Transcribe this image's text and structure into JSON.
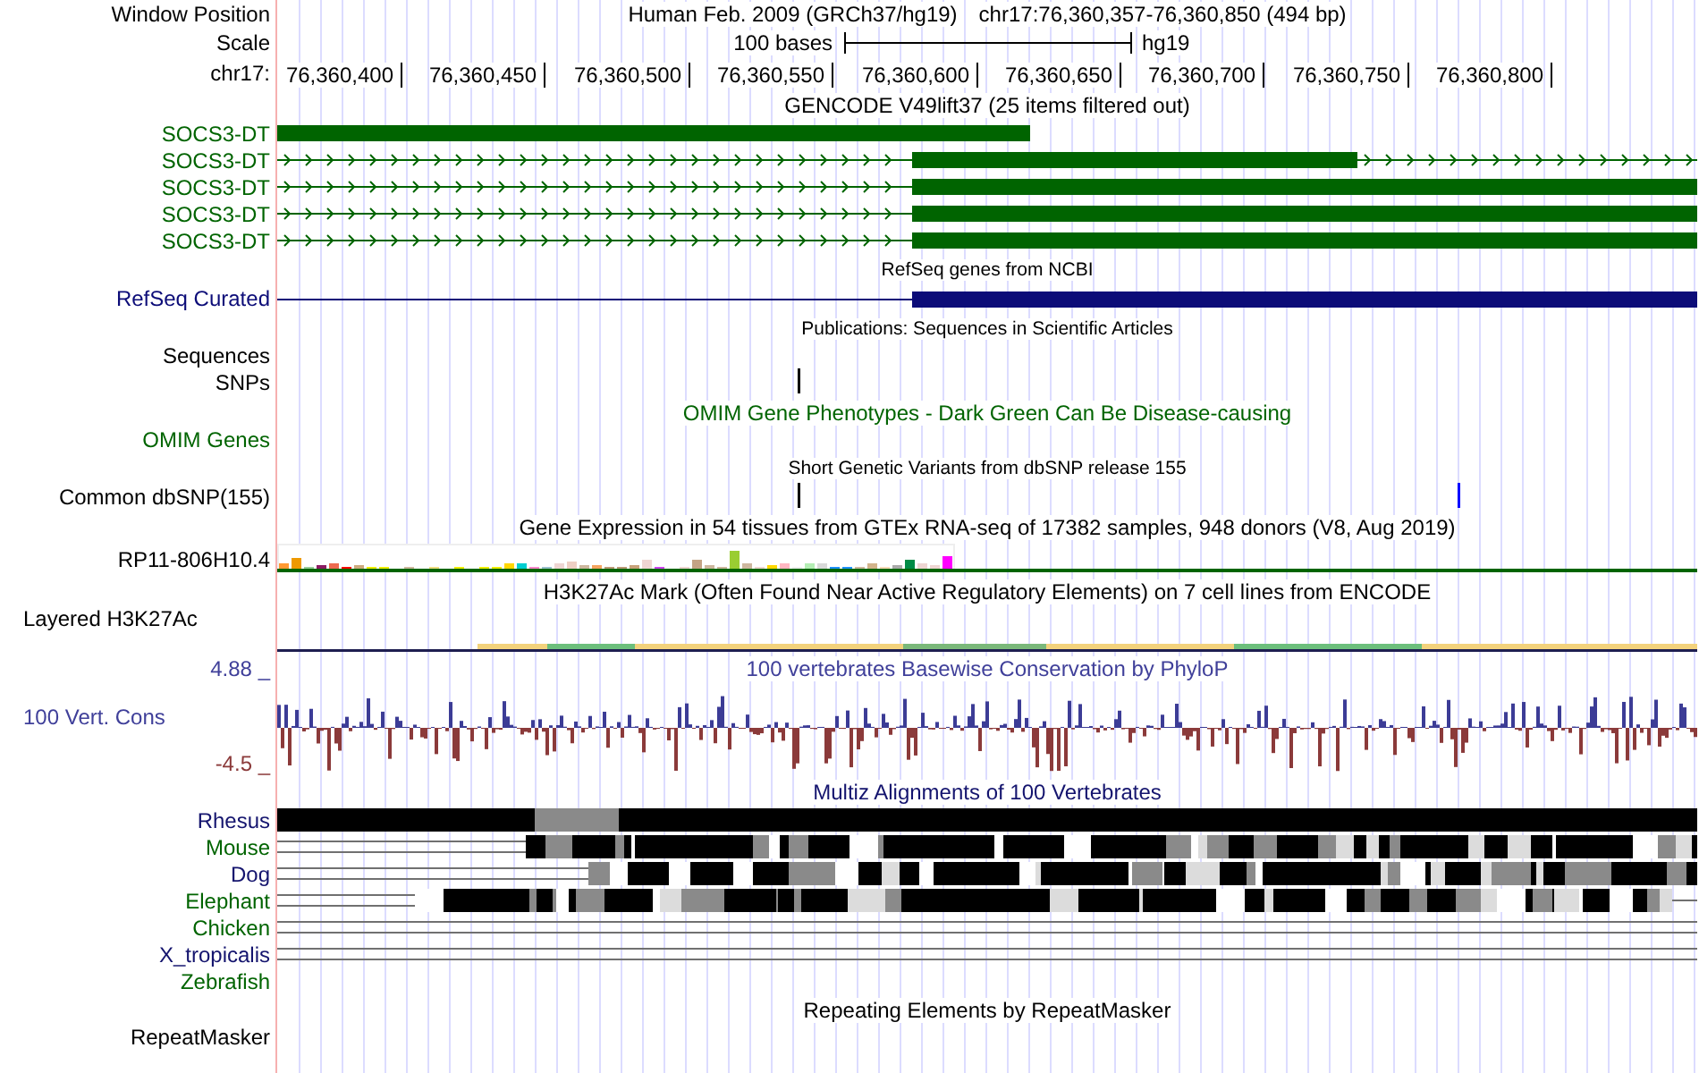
{
  "header": {
    "position_label": "Window Position",
    "assembly": "Human Feb. 2009 (GRCh37/hg19)",
    "position": "chr17:76,360,357-76,360,850 (494 bp)",
    "scale_label": "Scale",
    "scale_text": "100 bases",
    "scale_db": "hg19",
    "ruler_label": "chr17:",
    "ticks": [
      "76,360,400",
      "76,360,450",
      "76,360,500",
      "76,360,550",
      "76,360,600",
      "76,360,650",
      "76,360,700",
      "76,360,750",
      "76,360,800"
    ]
  },
  "tracks": [
    {
      "kind": "title",
      "text": "GENCODE V49lift37 (25 items filtered out)",
      "color": "#000000"
    },
    {
      "kind": "genes",
      "transcripts": [
        {
          "label": "SOCS3-DT",
          "kind": "single-block",
          "color": "#006400"
        },
        {
          "label": "SOCS3-DT",
          "kind": "short-exon",
          "color": "#006400"
        },
        {
          "label": "SOCS3-DT",
          "kind": "long-exon",
          "color": "#006400"
        },
        {
          "label": "SOCS3-DT",
          "kind": "long-exon",
          "color": "#006400"
        },
        {
          "label": "SOCS3-DT",
          "kind": "long-exon",
          "color": "#006400"
        }
      ]
    },
    {
      "kind": "note",
      "text": "RefSeq genes from NCBI"
    },
    {
      "kind": "refseq",
      "label": "RefSeq Curated",
      "color": "#0c0c78"
    },
    {
      "kind": "note",
      "text": "Publications: Sequences in Scientific Articles"
    },
    {
      "kind": "empty",
      "label": "Sequences",
      "color": "#000000"
    },
    {
      "kind": "variants",
      "label": "SNPs",
      "color": "#000000",
      "marks": [
        {
          "color": "#000000"
        }
      ]
    },
    {
      "kind": "title",
      "text": "OMIM Gene Phenotypes - Dark Green Can Be Disease-causing",
      "color": "#006400"
    },
    {
      "kind": "empty",
      "label": "OMIM Genes",
      "color": "#006400"
    },
    {
      "kind": "note",
      "text": "Short Genetic Variants from dbSNP release 155"
    },
    {
      "kind": "variants",
      "label": "Common dbSNP(155)",
      "color": "#000000",
      "marks": [
        {
          "color": "#000000"
        },
        {
          "color": "#0000ff"
        }
      ]
    },
    {
      "kind": "title",
      "text": "Gene Expression in 54 tissues from GTEx RNA-seq of 17382 samples, 948 donors (V8, Aug 2019)",
      "color": "#000000"
    },
    {
      "kind": "expression",
      "label": "RP11-806H10.4",
      "color": "#000000"
    },
    {
      "kind": "title",
      "text": "H3K27Ac Mark (Often Found Near Active Regulatory Elements) on 7 cell lines from ENCODE",
      "color": "#000000"
    },
    {
      "kind": "layered",
      "label": "Layered H3K27Ac",
      "color": "#000000"
    },
    {
      "kind": "conservation",
      "title": "100 vertebrates Basewise Conservation by PhyloP",
      "label": "100 Vert. Cons",
      "max": "4.88 _",
      "min": "-4.5 _",
      "color": "#40409a"
    },
    {
      "kind": "title",
      "text": "Multiz Alignments of 100 Vertebrates",
      "color": "#14146e"
    },
    {
      "kind": "alignments",
      "species": [
        {
          "label": "Rhesus",
          "kind": "blocks",
          "color": "#14146e"
        },
        {
          "label": "Mouse",
          "kind": "blocks",
          "color": "#006400"
        },
        {
          "label": "Dog",
          "kind": "blocks",
          "color": "#14146e"
        },
        {
          "label": "Elephant",
          "kind": "blocks",
          "color": "#006400"
        },
        {
          "label": "Chicken",
          "kind": "gaps",
          "color": "#006400"
        },
        {
          "label": "X_tropicalis",
          "kind": "gaps",
          "color": "#14146e"
        },
        {
          "label": "Zebrafish",
          "kind": "none",
          "color": "#006400"
        }
      ]
    },
    {
      "kind": "title",
      "text": "Repeating Elements by RepeatMasker",
      "color": "#000000"
    },
    {
      "kind": "empty",
      "label": "RepeatMasker",
      "color": "#000000"
    }
  ]
}
